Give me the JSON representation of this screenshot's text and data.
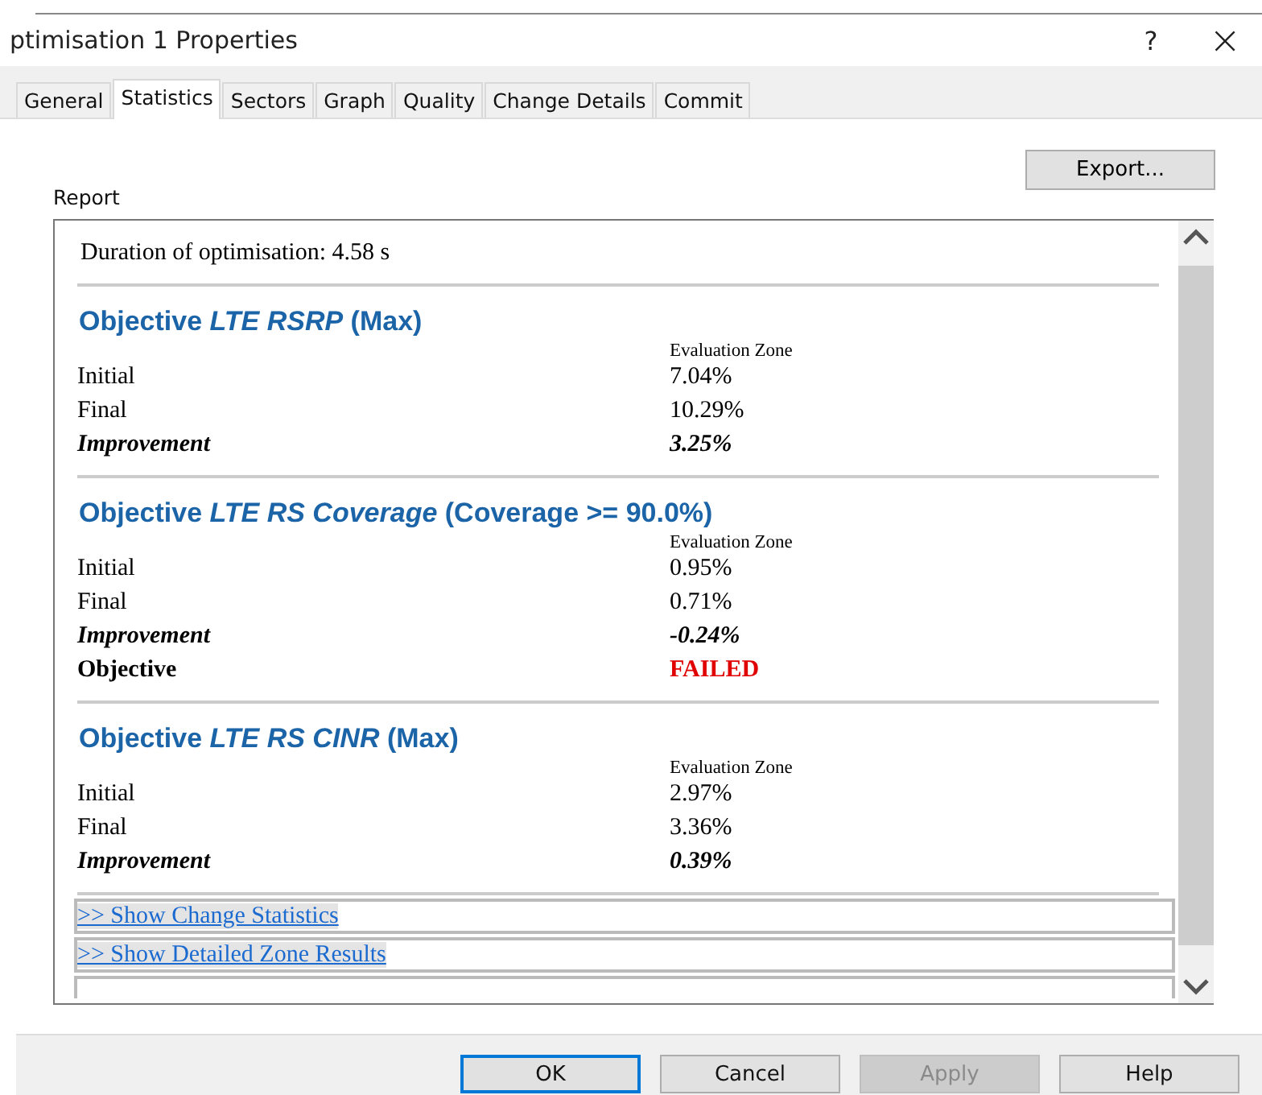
{
  "window": {
    "title": "ptimisation 1 Properties",
    "help": "?",
    "close": "×"
  },
  "tabs": [
    {
      "label": "General",
      "selected": false
    },
    {
      "label": "Statistics",
      "selected": true
    },
    {
      "label": "Sectors",
      "selected": false
    },
    {
      "label": "Graph",
      "selected": false
    },
    {
      "label": "Quality",
      "selected": false
    },
    {
      "label": "Change Details",
      "selected": false
    },
    {
      "label": "Commit",
      "selected": false
    }
  ],
  "export_button": "Export...",
  "report": {
    "label": "Report",
    "duration": "Duration of optimisation: 4.58 s",
    "objectives": [
      {
        "title": "Objective *LTE RSRP* (Max)",
        "column": "Evaluation Zone",
        "rows": [
          {
            "kind": "plain",
            "label": "Initial",
            "value": "7.04%"
          },
          {
            "kind": "plain",
            "label": "Final",
            "value": "10.29%"
          },
          {
            "kind": "improvement",
            "label": "Improvement",
            "value": "3.25%"
          }
        ]
      },
      {
        "title": "Objective *LTE RS Coverage* (Coverage >= 90.0%)",
        "column": "Evaluation Zone",
        "rows": [
          {
            "kind": "plain",
            "label": "Initial",
            "value": "0.95%"
          },
          {
            "kind": "plain",
            "label": "Final",
            "value": "0.71%"
          },
          {
            "kind": "improvement",
            "label": "Improvement",
            "value": "-0.24%"
          },
          {
            "kind": "status",
            "label": "Objective",
            "value": "FAILED"
          }
        ]
      },
      {
        "title": "Objective *LTE RS CINR* (Max)",
        "column": "Evaluation Zone",
        "rows": [
          {
            "kind": "plain",
            "label": "Initial",
            "value": "2.97%"
          },
          {
            "kind": "plain",
            "label": "Final",
            "value": "3.36%"
          },
          {
            "kind": "improvement",
            "label": "Improvement",
            "value": "0.39%"
          }
        ]
      }
    ],
    "links": [
      ">> Show Change Statistics",
      ">> Show Detailed Zone Results"
    ]
  },
  "buttons": [
    {
      "label": "OK",
      "default": true,
      "disabled": false
    },
    {
      "label": "Cancel",
      "default": false,
      "disabled": false
    },
    {
      "label": "Apply",
      "default": false,
      "disabled": true
    },
    {
      "label": "Help",
      "default": false,
      "disabled": false
    }
  ]
}
